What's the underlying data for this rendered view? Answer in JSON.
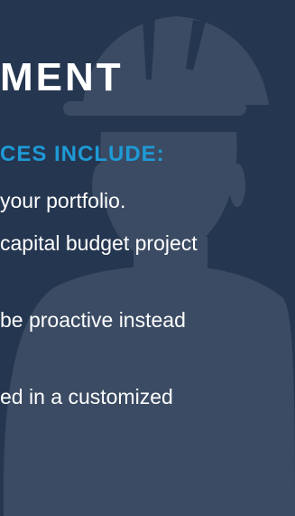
{
  "colors": {
    "background": "#253650",
    "figure": "#3b4b63",
    "heading": "#ffffff",
    "accent": "#1e9ad6",
    "body_text": "#ffffff"
  },
  "decoration": {
    "icon": "construction-worker-hardhat-icon"
  },
  "heading": {
    "title": "MENT",
    "subtitle": "CES INCLUDE:"
  },
  "lines": [
    " your portfolio.",
    "capital budget project",
    "be proactive instead",
    "ed in a customized"
  ]
}
